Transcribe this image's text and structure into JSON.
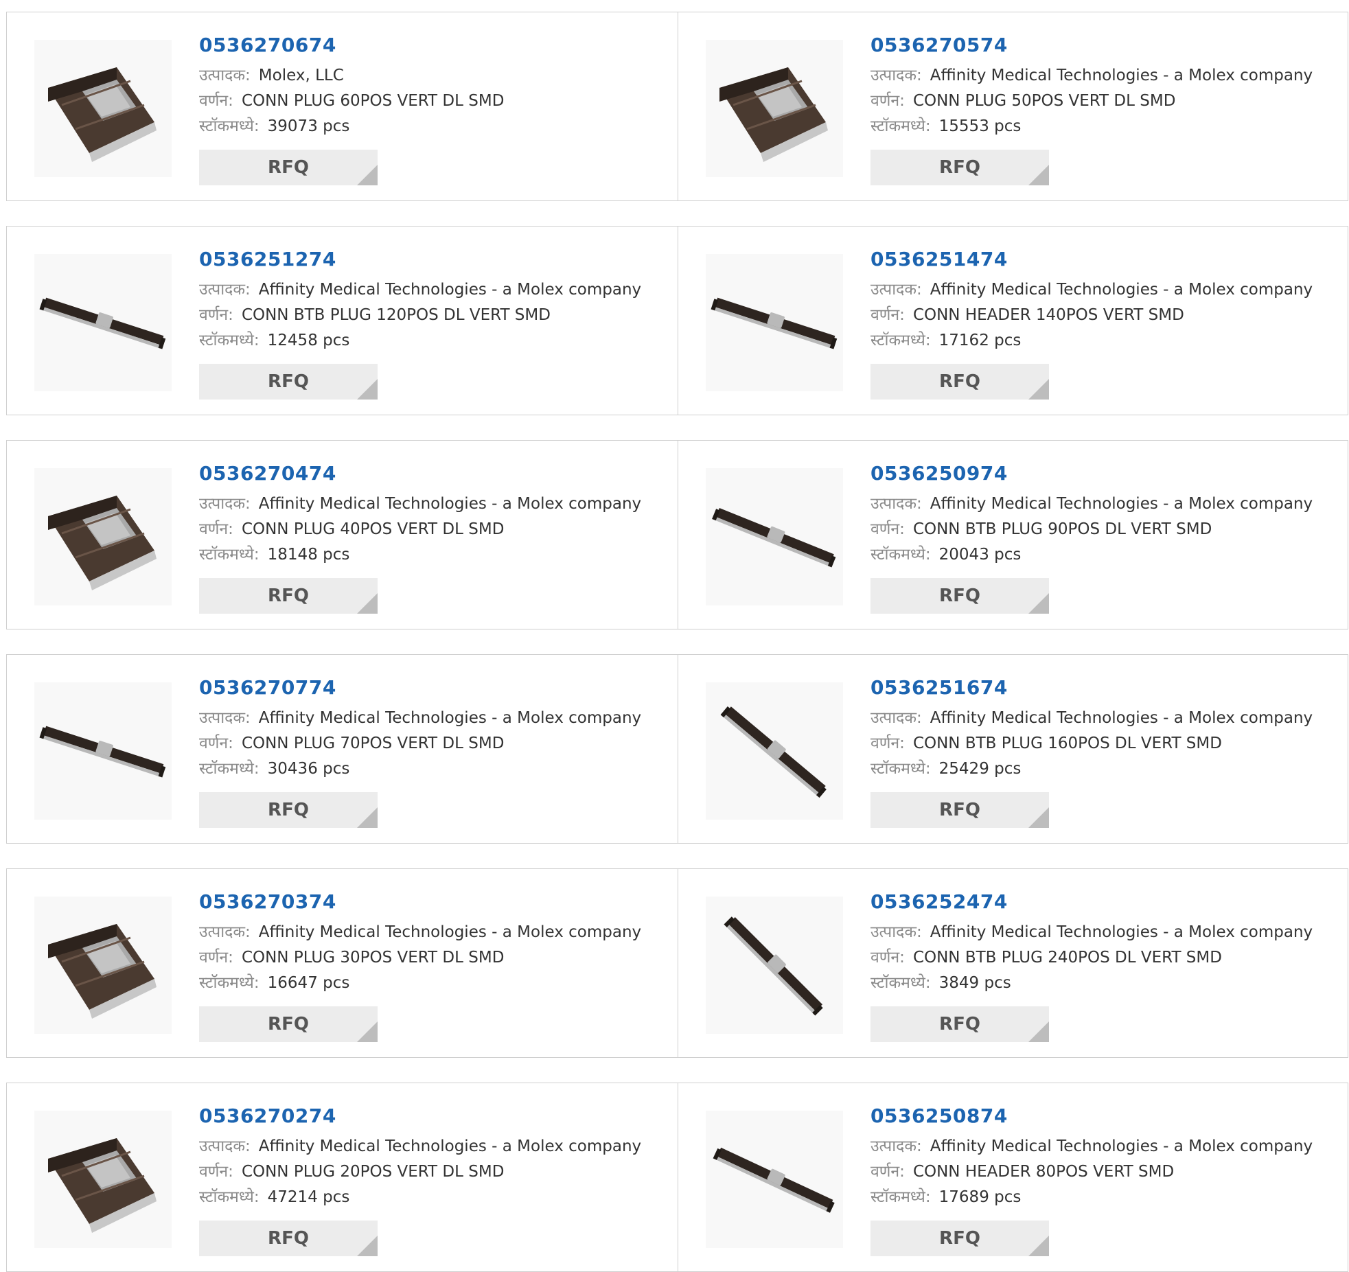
{
  "labels": {
    "manufacturer": "उत्पादक:",
    "description": "वर्णन:",
    "stock": "स्टॉकमध्ये:",
    "rfq": "RFQ"
  },
  "colors": {
    "part_number": "#1c64b0",
    "border": "#cfcfcf",
    "button_bg": "#ececec"
  },
  "products": [
    {
      "part": "0536270674",
      "manufacturer": "Molex, LLC",
      "description": "CONN PLUG 60POS VERT DL SMD",
      "stock": "39073 pcs",
      "icon": "connector-block-image"
    },
    {
      "part": "0536270574",
      "manufacturer": "Affinity Medical Technologies - a Molex company",
      "description": "CONN PLUG 50POS VERT DL SMD",
      "stock": "15553 pcs",
      "icon": "connector-block-image"
    },
    {
      "part": "0536251274",
      "manufacturer": "Affinity Medical Technologies - a Molex company",
      "description": "CONN BTB PLUG 120POS DL VERT SMD",
      "stock": "12458 pcs",
      "icon": "connector-strip-image"
    },
    {
      "part": "0536251474",
      "manufacturer": "Affinity Medical Technologies - a Molex company",
      "description": "CONN HEADER 140POS VERT SMD",
      "stock": "17162 pcs",
      "icon": "connector-strip-image"
    },
    {
      "part": "0536270474",
      "manufacturer": "Affinity Medical Technologies - a Molex company",
      "description": "CONN PLUG 40POS VERT DL SMD",
      "stock": "18148 pcs",
      "icon": "connector-block-image"
    },
    {
      "part": "0536250974",
      "manufacturer": "Affinity Medical Technologies - a Molex company",
      "description": "CONN BTB PLUG 90POS DL VERT SMD",
      "stock": "20043 pcs",
      "icon": "connector-strip-image"
    },
    {
      "part": "0536270774",
      "manufacturer": "Affinity Medical Technologies - a Molex company",
      "description": "CONN PLUG 70POS VERT DL SMD",
      "stock": "30436 pcs",
      "icon": "connector-strip-image"
    },
    {
      "part": "0536251674",
      "manufacturer": "Affinity Medical Technologies - a Molex company",
      "description": "CONN BTB PLUG 160POS DL VERT SMD",
      "stock": "25429 pcs",
      "icon": "connector-strip-image"
    },
    {
      "part": "0536270374",
      "manufacturer": "Affinity Medical Technologies - a Molex company",
      "description": "CONN PLUG 30POS VERT DL SMD",
      "stock": "16647 pcs",
      "icon": "connector-block-image"
    },
    {
      "part": "0536252474",
      "manufacturer": "Affinity Medical Technologies - a Molex company",
      "description": "CONN BTB PLUG 240POS DL VERT SMD",
      "stock": "3849 pcs",
      "icon": "connector-strip-image"
    },
    {
      "part": "0536270274",
      "manufacturer": "Affinity Medical Technologies - a Molex company",
      "description": "CONN PLUG 20POS VERT DL SMD",
      "stock": "47214 pcs",
      "icon": "connector-block-image"
    },
    {
      "part": "0536250874",
      "manufacturer": "Affinity Medical Technologies - a Molex company",
      "description": "CONN HEADER 80POS VERT SMD",
      "stock": "17689 pcs",
      "icon": "connector-strip-image"
    }
  ]
}
